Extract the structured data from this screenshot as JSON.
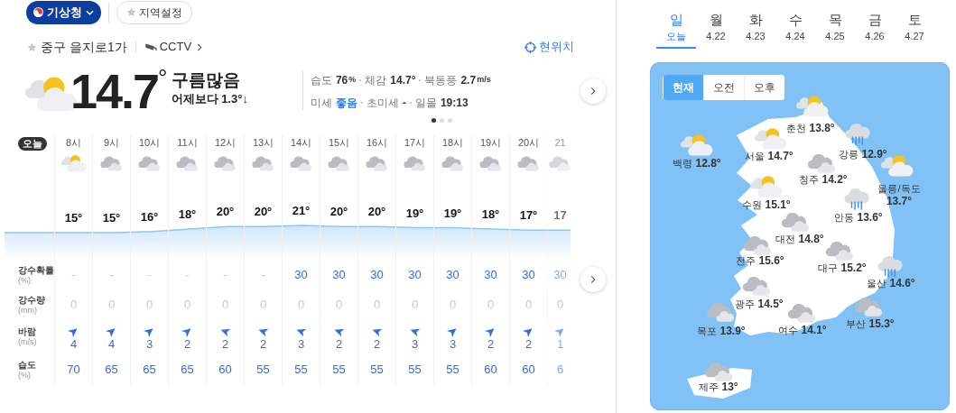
{
  "source": {
    "label": "기상청"
  },
  "region_button": {
    "label": "지역설정"
  },
  "location": {
    "name": "중구 을지로1가",
    "cctv": "CCTV",
    "current": "현위치"
  },
  "current": {
    "kind": "partly_cloudy",
    "temp": "14.7",
    "degree": "°",
    "condition": "구름많음",
    "compare": "어제보다 1.3°↓"
  },
  "details": [
    [
      {
        "label": "습도",
        "value": "76",
        "unit": "%",
        "good": false
      },
      {
        "label": "체감",
        "value": "14.7°",
        "good": false
      },
      {
        "label": "북동풍",
        "value": "2.7",
        "unit": "m/s",
        "good": false
      }
    ],
    [
      {
        "label": "미세",
        "value": "좋음",
        "good": true
      },
      {
        "label": "초미세",
        "value": "-",
        "good": false
      },
      {
        "label": "일몰",
        "value": "19:13",
        "good": false
      }
    ]
  ],
  "pages": [
    {
      "selected": true
    },
    {
      "selected": false
    },
    {
      "selected": false
    }
  ],
  "hourly": {
    "today": "오늘",
    "row_labels": [
      {
        "label": "강수확률",
        "unit": "(%)"
      },
      {
        "label": "강수량",
        "unit": "(mm)"
      },
      {
        "label": "바람",
        "unit": "(m/s)"
      },
      {
        "label": "습도",
        "unit": "(%)"
      }
    ],
    "hours": [
      {
        "time": "8시",
        "kind": "partly_cloudy",
        "temp": "15°",
        "chance": "-",
        "chance_dim": true,
        "amount": "0",
        "wind": {
          "kind": "ne",
          "speed": "4"
        },
        "humidity": "70",
        "faded": false
      },
      {
        "time": "9시",
        "kind": "cloudy",
        "temp": "15°",
        "chance": "-",
        "chance_dim": true,
        "amount": "0",
        "wind": {
          "kind": "ne",
          "speed": "4"
        },
        "humidity": "65",
        "faded": false
      },
      {
        "time": "10시",
        "kind": "cloudy",
        "temp": "16°",
        "chance": "-",
        "chance_dim": true,
        "amount": "0",
        "wind": {
          "kind": "ne",
          "speed": "3"
        },
        "humidity": "65",
        "faded": false
      },
      {
        "time": "11시",
        "kind": "cloudy",
        "temp": "18°",
        "chance": "-",
        "chance_dim": true,
        "amount": "0",
        "wind": {
          "kind": "ne",
          "speed": "2"
        },
        "humidity": "65",
        "faded": false
      },
      {
        "time": "12시",
        "kind": "cloudy",
        "temp": "20°",
        "chance": "-",
        "chance_dim": true,
        "amount": "0",
        "wind": {
          "kind": "w",
          "speed": "2"
        },
        "humidity": "60",
        "faded": false
      },
      {
        "time": "13시",
        "kind": "cloudy",
        "temp": "20°",
        "chance": "-",
        "chance_dim": true,
        "amount": "0",
        "wind": {
          "kind": "w",
          "speed": "2"
        },
        "humidity": "55",
        "faded": false
      },
      {
        "time": "14시",
        "kind": "cloudy",
        "temp": "21°",
        "chance": "30",
        "chance_dim": false,
        "amount": "0",
        "wind": {
          "kind": "w",
          "speed": "3"
        },
        "humidity": "55",
        "faded": false
      },
      {
        "time": "15시",
        "kind": "cloudy",
        "temp": "20°",
        "chance": "30",
        "chance_dim": false,
        "amount": "0",
        "wind": {
          "kind": "w",
          "speed": "2"
        },
        "humidity": "55",
        "faded": false
      },
      {
        "time": "16시",
        "kind": "cloudy",
        "temp": "20°",
        "chance": "30",
        "chance_dim": false,
        "amount": "0",
        "wind": {
          "kind": "w",
          "speed": "2"
        },
        "humidity": "55",
        "faded": false
      },
      {
        "time": "17시",
        "kind": "cloudy",
        "temp": "19°",
        "chance": "30",
        "chance_dim": false,
        "amount": "0",
        "wind": {
          "kind": "w",
          "speed": "3"
        },
        "humidity": "55",
        "faded": false
      },
      {
        "time": "18시",
        "kind": "cloudy",
        "temp": "19°",
        "chance": "30",
        "chance_dim": false,
        "amount": "0",
        "wind": {
          "kind": "ne",
          "speed": "3"
        },
        "humidity": "55",
        "faded": false
      },
      {
        "time": "19시",
        "kind": "cloudy",
        "temp": "18°",
        "chance": "30",
        "chance_dim": false,
        "amount": "0",
        "wind": {
          "kind": "ne",
          "speed": "2"
        },
        "humidity": "60",
        "faded": false
      },
      {
        "time": "20시",
        "kind": "cloudy",
        "temp": "17°",
        "chance": "30",
        "chance_dim": false,
        "amount": "0",
        "wind": {
          "kind": "ne",
          "speed": "2"
        },
        "humidity": "60",
        "faded": false
      },
      {
        "time": "21",
        "kind": "cloudy",
        "temp": "17",
        "chance": "30",
        "chance_dim": false,
        "amount": "0",
        "wind": {
          "kind": "ne",
          "speed": "1"
        },
        "humidity": "6",
        "faded": true
      }
    ]
  },
  "days": [
    {
      "day": "일",
      "date": "오늘",
      "selected": true
    },
    {
      "day": "월",
      "date": "4.22",
      "selected": false
    },
    {
      "day": "화",
      "date": "4.23",
      "selected": false
    },
    {
      "day": "수",
      "date": "4.24",
      "selected": false
    },
    {
      "day": "목",
      "date": "4.25",
      "selected": false
    },
    {
      "day": "금",
      "date": "4.26",
      "selected": false
    },
    {
      "day": "토",
      "date": "4.27",
      "selected": false
    }
  ],
  "periods": [
    {
      "label": "현재",
      "selected": true
    },
    {
      "label": "오전",
      "selected": false
    },
    {
      "label": "오후",
      "selected": false
    }
  ],
  "cities": [
    {
      "name": "춘천",
      "temp": "13.8°",
      "kind": "partly_cloudy"
    },
    {
      "name": "서울",
      "temp": "14.7°",
      "kind": "partly_cloudy"
    },
    {
      "name": "강릉",
      "temp": "12.9°",
      "kind": "rain"
    },
    {
      "name": "백령",
      "temp": "12.8°",
      "kind": "partly_cloudy"
    },
    {
      "name": "청주",
      "temp": "14.2°",
      "kind": "cloudy"
    },
    {
      "name": "울릉/독도",
      "temp": "13.7°",
      "kind": "partly_cloudy"
    },
    {
      "name": "수원",
      "temp": "15.1°",
      "kind": "partly_cloudy"
    },
    {
      "name": "안동",
      "temp": "13.6°",
      "kind": "rain"
    },
    {
      "name": "대전",
      "temp": "14.8°",
      "kind": "cloudy"
    },
    {
      "name": "전주",
      "temp": "15.6°",
      "kind": "cloudy"
    },
    {
      "name": "대구",
      "temp": "15.2°",
      "kind": "cloudy"
    },
    {
      "name": "울산",
      "temp": "14.6°",
      "kind": "rain"
    },
    {
      "name": "광주",
      "temp": "14.5°",
      "kind": "cloudy"
    },
    {
      "name": "부산",
      "temp": "15.3°",
      "kind": "cloudy"
    },
    {
      "name": "목포",
      "temp": "13.9°",
      "kind": "cloudy"
    },
    {
      "name": "여수",
      "temp": "14.1°",
      "kind": "cloudy"
    },
    {
      "name": "제주",
      "temp": "13°",
      "kind": "cloudy"
    }
  ]
}
